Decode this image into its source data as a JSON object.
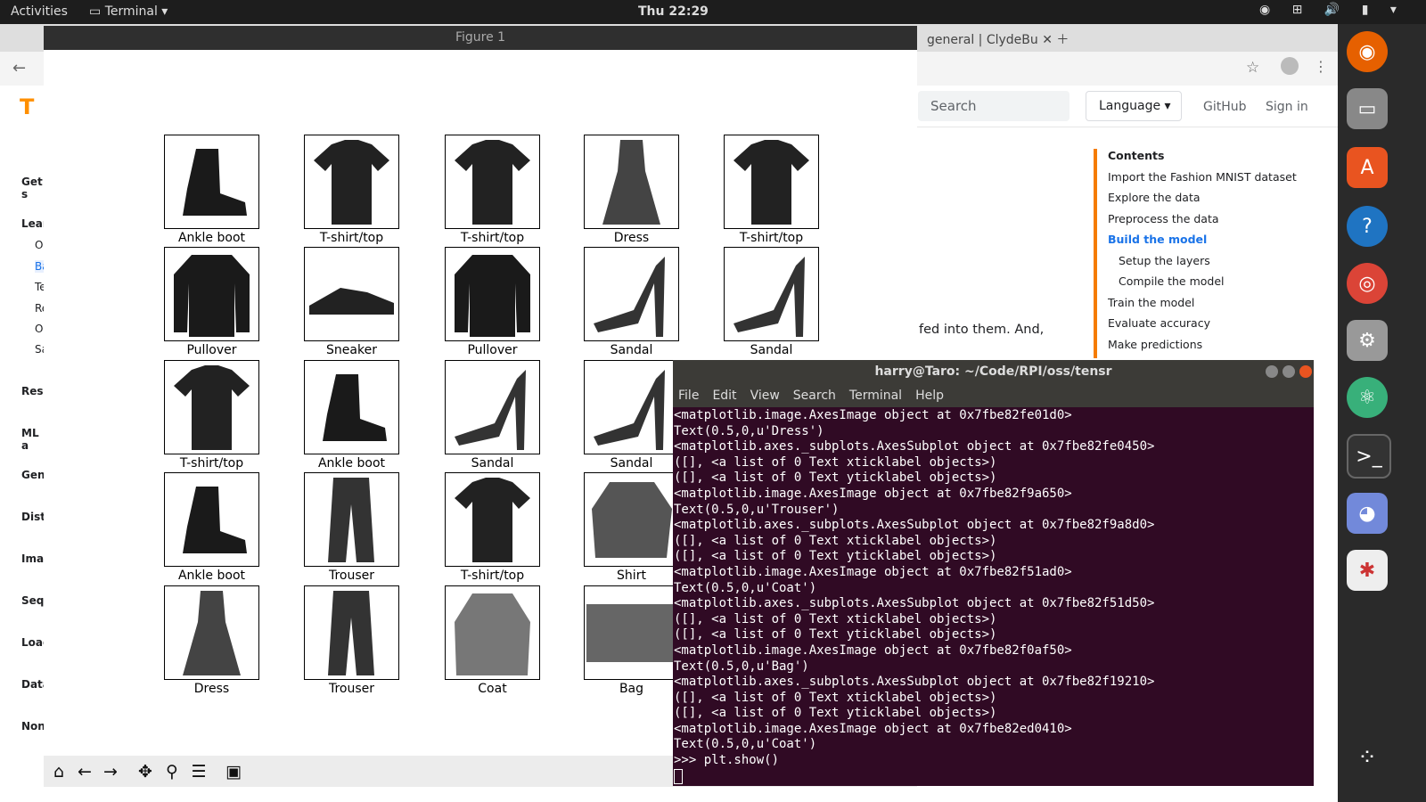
{
  "topbar": {
    "activities": "Activities",
    "app_name": "Terminal",
    "clock": "Thu 22:29"
  },
  "browser": {
    "tab_title": "general | ClydeBu",
    "search_placeholder": "Search",
    "language_label": "Language",
    "github_label": "GitHub",
    "signin_label": "Sign in",
    "body_text": "fed into them. And,",
    "toc": [
      "Contents",
      "Import the Fashion MNIST dataset",
      "Explore the data",
      "Preprocess the data",
      "Build the model",
      "Setup the layers",
      "Compile the model",
      "Train the model",
      "Evaluate accuracy",
      "Make predictions"
    ],
    "left_nav": [
      "Get s",
      "Lear",
      "O",
      "Ba",
      "Te",
      "Re",
      "O",
      "Sa",
      "Rese",
      "ML a",
      "Gene",
      "Distr",
      "Imag",
      "Sequ",
      "Load",
      "Data",
      "Non-"
    ]
  },
  "figure": {
    "title": "Figure 1",
    "labels": [
      "Ankle boot",
      "T-shirt/top",
      "T-shirt/top",
      "Dress",
      "T-shirt/top",
      "Pullover",
      "Sneaker",
      "Pullover",
      "Sandal",
      "Sandal",
      "T-shirt/top",
      "Ankle boot",
      "Sandal",
      "Sandal",
      "Ankle boot",
      "Trouser",
      "T-shirt/top",
      "Shirt",
      "Dress",
      "Trouser",
      "Coat",
      "Bag"
    ]
  },
  "terminal": {
    "title": "harry@Taro: ~/Code/RPI/oss/tensr",
    "menu": [
      "File",
      "Edit",
      "View",
      "Search",
      "Terminal",
      "Help"
    ],
    "lines": [
      "<matplotlib.image.AxesImage object at 0x7fbe82fe01d0>",
      "Text(0.5,0,u'Dress')",
      "<matplotlib.axes._subplots.AxesSubplot object at 0x7fbe82fe0450>",
      "([], <a list of 0 Text xticklabel objects>)",
      "([], <a list of 0 Text yticklabel objects>)",
      "<matplotlib.image.AxesImage object at 0x7fbe82f9a650>",
      "Text(0.5,0,u'Trouser')",
      "<matplotlib.axes._subplots.AxesSubplot object at 0x7fbe82f9a8d0>",
      "([], <a list of 0 Text xticklabel objects>)",
      "([], <a list of 0 Text yticklabel objects>)",
      "<matplotlib.image.AxesImage object at 0x7fbe82f51ad0>",
      "Text(0.5,0,u'Coat')",
      "<matplotlib.axes._subplots.AxesSubplot object at 0x7fbe82f51d50>",
      "([], <a list of 0 Text xticklabel objects>)",
      "([], <a list of 0 Text yticklabel objects>)",
      "<matplotlib.image.AxesImage object at 0x7fbe82f0af50>",
      "Text(0.5,0,u'Bag')",
      "<matplotlib.axes._subplots.AxesSubplot object at 0x7fbe82f19210>",
      "([], <a list of 0 Text xticklabel objects>)",
      "([], <a list of 0 Text yticklabel objects>)",
      "<matplotlib.image.AxesImage object at 0x7fbe82ed0410>",
      "Text(0.5,0,u'Coat')",
      ">>> plt.show()"
    ]
  }
}
